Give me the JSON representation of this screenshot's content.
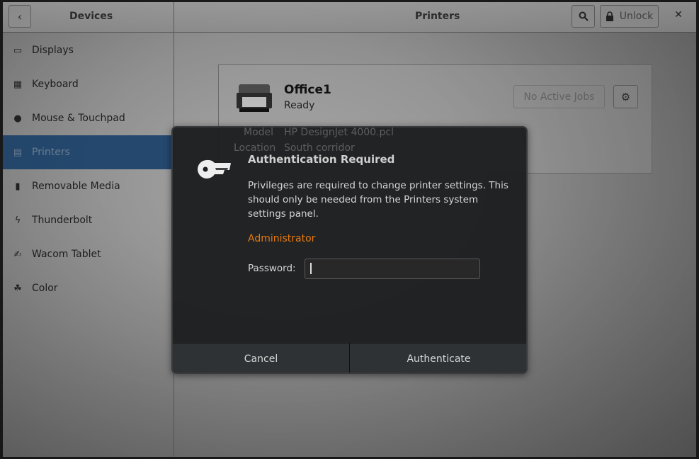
{
  "header": {
    "left_title": "Devices",
    "title": "Printers",
    "unlock_label": "Unlock",
    "icons": {
      "back": "chevron-left-icon",
      "search": "search-icon",
      "lock": "lock-icon",
      "close": "close-icon"
    }
  },
  "sidebar": {
    "items": [
      {
        "label": "Displays",
        "icon": "display-icon",
        "glyph": "▭"
      },
      {
        "label": "Keyboard",
        "icon": "keyboard-icon",
        "glyph": "▦"
      },
      {
        "label": "Mouse & Touchpad",
        "icon": "mouse-icon",
        "glyph": "●"
      },
      {
        "label": "Printers",
        "icon": "printer-icon",
        "glyph": "▤",
        "selected": true
      },
      {
        "label": "Removable Media",
        "icon": "usb-icon",
        "glyph": "▮"
      },
      {
        "label": "Thunderbolt",
        "icon": "thunderbolt-icon",
        "glyph": "ϟ"
      },
      {
        "label": "Wacom Tablet",
        "icon": "tablet-icon",
        "glyph": "✍"
      },
      {
        "label": "Color",
        "icon": "color-icon",
        "glyph": "☘"
      }
    ]
  },
  "printer": {
    "name": "Office1",
    "status": "Ready",
    "jobs_label": "No Active Jobs",
    "model_label": "Model",
    "model": "HP DesignJet 4000.pcl",
    "location_label": "Location",
    "location": "South corridor"
  },
  "dialog": {
    "title": "Authentication Required",
    "message": "Privileges are required to change printer settings. This should only be needed from the Printers system settings panel.",
    "user": "Administrator",
    "password_label": "Password:",
    "password_value": "",
    "cancel": "Cancel",
    "authenticate": "Authenticate",
    "accent": "#e57a10"
  }
}
